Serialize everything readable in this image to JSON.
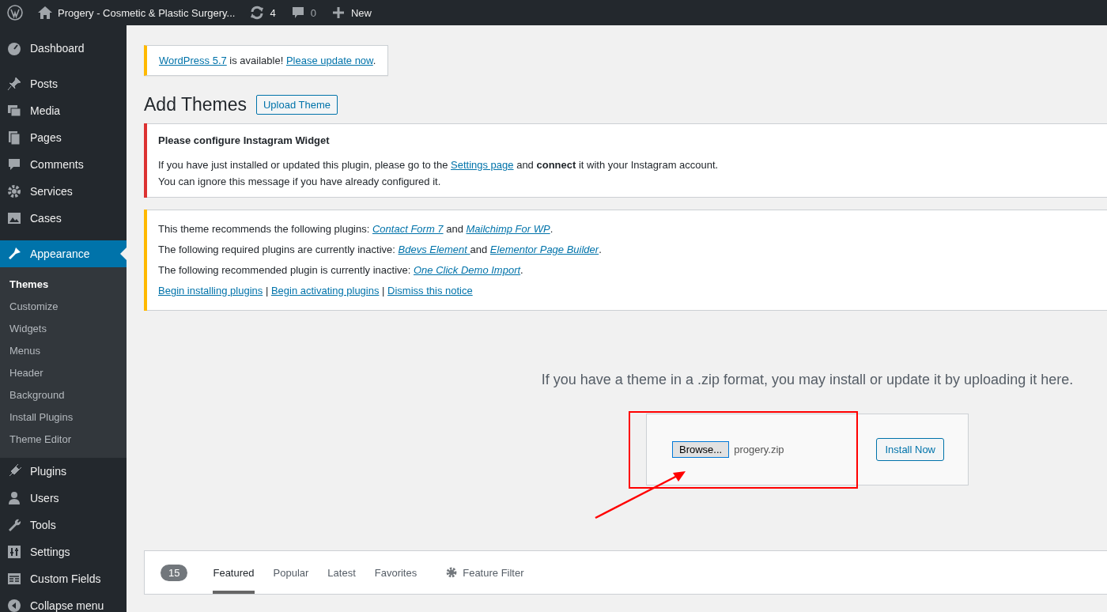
{
  "admin_bar": {
    "site_title": "Progery - Cosmetic & Plastic Surgery...",
    "updates": "4",
    "comments": "0",
    "new": "New"
  },
  "sidebar": {
    "groups": [
      [
        {
          "label": "Dashboard",
          "selected": false
        }
      ],
      [
        {
          "label": "Posts",
          "selected": false
        },
        {
          "label": "Media",
          "selected": false
        },
        {
          "label": "Pages",
          "selected": false
        },
        {
          "label": "Comments",
          "selected": false
        },
        {
          "label": "Services",
          "selected": false
        },
        {
          "label": "Cases",
          "selected": false
        }
      ],
      [
        {
          "label": "Appearance",
          "selected": true,
          "children": [
            {
              "label": "Themes",
              "selected": true
            },
            {
              "label": "Customize",
              "selected": false
            },
            {
              "label": "Widgets",
              "selected": false
            },
            {
              "label": "Menus",
              "selected": false
            },
            {
              "label": "Header",
              "selected": false
            },
            {
              "label": "Background",
              "selected": false
            },
            {
              "label": "Install Plugins",
              "selected": false
            },
            {
              "label": "Theme Editor",
              "selected": false
            }
          ]
        },
        {
          "label": "Plugins",
          "selected": false
        },
        {
          "label": "Users",
          "selected": false
        },
        {
          "label": "Tools",
          "selected": false
        },
        {
          "label": "Settings",
          "selected": false
        },
        {
          "label": "Custom Fields",
          "selected": false
        },
        {
          "label": "Collapse menu",
          "selected": false
        }
      ]
    ]
  },
  "update_nag": [
    {
      "kind": "link",
      "text": "WordPress 5.7"
    },
    {
      "kind": "text",
      "text": " is available! "
    },
    {
      "kind": "link",
      "text": "Please update now"
    },
    {
      "kind": "text",
      "text": "."
    }
  ],
  "page_title": "Add Themes",
  "upload_theme_button": "Upload Theme",
  "notices": [
    {
      "color": "#dc3232",
      "italic_links": false,
      "title": "Please configure Instagram Widget",
      "lines": [
        [
          {
            "kind": "text",
            "text": "If you have just installed or updated this plugin, please go to the "
          },
          {
            "kind": "link",
            "text": "Settings page"
          },
          {
            "kind": "text",
            "text": " and "
          },
          {
            "kind": "bold",
            "text": "connect"
          },
          {
            "kind": "text",
            "text": " it with your Instagram account."
          }
        ],
        [
          {
            "kind": "text",
            "text": "You can ignore this message if you have already configured it."
          }
        ]
      ]
    },
    {
      "color": "#ffb900",
      "italic_links": true,
      "lines": [
        [
          {
            "kind": "text",
            "text": "This theme recommends the following plugins: "
          },
          {
            "kind": "link",
            "text": "Contact Form 7"
          },
          {
            "kind": "text",
            "text": " and "
          },
          {
            "kind": "link",
            "text": "Mailchimp For WP"
          },
          {
            "kind": "text",
            "text": "."
          }
        ],
        [
          {
            "kind": "text",
            "text": "The following required plugins are currently inactive: "
          },
          {
            "kind": "link",
            "text": "Bdevs Element "
          },
          {
            "kind": "text",
            "text": "and "
          },
          {
            "kind": "link",
            "text": "Elementor Page Builder"
          },
          {
            "kind": "text",
            "text": "."
          }
        ],
        [
          {
            "kind": "text",
            "text": "The following recommended plugin is currently inactive: "
          },
          {
            "kind": "link",
            "text": "One Click Demo Import"
          },
          {
            "kind": "text",
            "text": "."
          }
        ],
        [
          {
            "kind": "plainlink",
            "text": "Begin installing plugins"
          },
          {
            "kind": "text",
            "text": " | "
          },
          {
            "kind": "plainlink",
            "text": "Begin activating plugins"
          },
          {
            "kind": "text",
            "text": " | "
          },
          {
            "kind": "plainlink",
            "text": "Dismiss this notice"
          }
        ]
      ]
    }
  ],
  "upload": {
    "help": "If you have a theme in a .zip format, you may install or update it by uploading it here.",
    "browse_button": "Browse...",
    "file_name": "progery.zip",
    "install_button": "Install Now"
  },
  "filter_bar": {
    "count": "15",
    "tabs": [
      {
        "label": "Featured",
        "selected": true
      },
      {
        "label": "Popular",
        "selected": false
      },
      {
        "label": "Latest",
        "selected": false
      },
      {
        "label": "Favorites",
        "selected": false
      }
    ],
    "feature_filter": "Feature Filter"
  }
}
